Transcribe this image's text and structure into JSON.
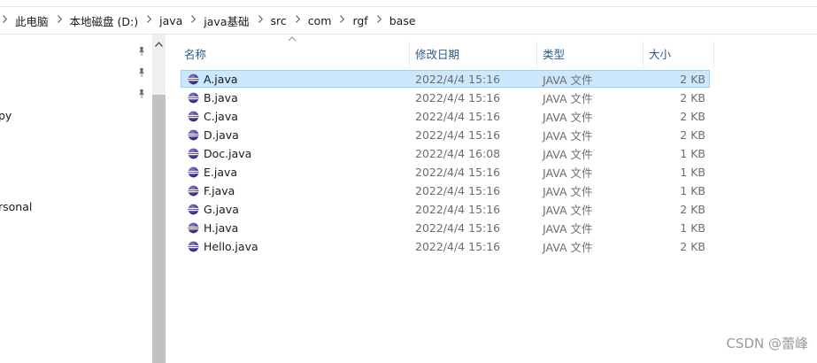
{
  "breadcrumb": [
    "此电脑",
    "本地磁盘 (D:)",
    "java",
    "java基础",
    "src",
    "com",
    "rgf",
    "base"
  ],
  "nav": {
    "items": [
      "py",
      "rsonal"
    ]
  },
  "columns": {
    "name": "名称",
    "date": "修改日期",
    "type": "类型",
    "size": "大小"
  },
  "files": [
    {
      "name": "A.java",
      "date": "2022/4/4 15:16",
      "type": "JAVA 文件",
      "size": "2 KB",
      "selected": true
    },
    {
      "name": "B.java",
      "date": "2022/4/4 15:16",
      "type": "JAVA 文件",
      "size": "2 KB"
    },
    {
      "name": "C.java",
      "date": "2022/4/4 15:16",
      "type": "JAVA 文件",
      "size": "2 KB"
    },
    {
      "name": "D.java",
      "date": "2022/4/4 15:16",
      "type": "JAVA 文件",
      "size": "2 KB"
    },
    {
      "name": "Doc.java",
      "date": "2022/4/4 16:08",
      "type": "JAVA 文件",
      "size": "1 KB"
    },
    {
      "name": "E.java",
      "date": "2022/4/4 15:16",
      "type": "JAVA 文件",
      "size": "1 KB"
    },
    {
      "name": "F.java",
      "date": "2022/4/4 15:16",
      "type": "JAVA 文件",
      "size": "1 KB"
    },
    {
      "name": "G.java",
      "date": "2022/4/4 15:16",
      "type": "JAVA 文件",
      "size": "2 KB"
    },
    {
      "name": "H.java",
      "date": "2022/4/4 15:16",
      "type": "JAVA 文件",
      "size": "1 KB"
    },
    {
      "name": "Hello.java",
      "date": "2022/4/4 15:16",
      "type": "JAVA 文件",
      "size": "2 KB"
    }
  ],
  "watermark": "CSDN @蕾峰",
  "icons": {
    "separator": "chevron-right-icon",
    "pin": "pin-icon",
    "sort": "sort-up-icon",
    "file": "eclipse-java-file-icon"
  },
  "colors": {
    "selection_bg": "#cce8ff",
    "selection_border": "#99d1ff",
    "header_text": "#2b5a8c",
    "meta_text": "#6d6d6d"
  }
}
